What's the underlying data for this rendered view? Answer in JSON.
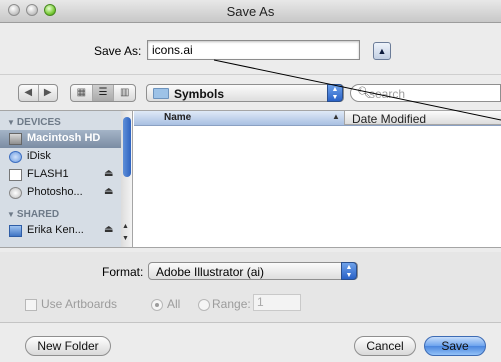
{
  "window": {
    "title": "Save As"
  },
  "save_as": {
    "label": "Save As:",
    "filename": "icons.ai",
    "toggle_icon": "up-triangle-icon"
  },
  "toolbar": {
    "back_icon": "back-arrow-icon",
    "forward_icon": "forward-arrow-icon",
    "view_icons": [
      "icon-view-icon",
      "list-view-icon",
      "column-view-icon"
    ],
    "location": "Symbols",
    "search_placeholder": "search"
  },
  "sidebar": {
    "sections": [
      {
        "heading": "DEVICES",
        "items": [
          {
            "label": "Macintosh HD",
            "selected": true,
            "icon": "hard-drive-icon",
            "eject": false
          },
          {
            "label": "iDisk",
            "selected": false,
            "icon": "idisk-icon",
            "eject": false
          },
          {
            "label": "FLASH1",
            "selected": false,
            "icon": "removable-drive-icon",
            "eject": true
          },
          {
            "label": "Photosho...",
            "selected": false,
            "icon": "disk-image-icon",
            "eject": true
          }
        ]
      },
      {
        "heading": "SHARED",
        "items": [
          {
            "label": "Erika Ken...",
            "selected": false,
            "icon": "network-computer-icon",
            "eject": true
          }
        ]
      }
    ]
  },
  "file_list": {
    "columns": [
      "Name",
      "Date Modified"
    ],
    "sorted_by": "Name"
  },
  "options": {
    "format_label": "Format:",
    "format_value": "Adobe Illustrator (ai)",
    "use_artboards_label": "Use Artboards",
    "all_label": "All",
    "range_label": "Range:",
    "range_value": "1"
  },
  "buttons": {
    "new_folder": "New Folder",
    "cancel": "Cancel",
    "save": "Save"
  },
  "colors": {
    "accent": "#4a86df",
    "sidebar_bg": "#d6dde5",
    "selection": "#7b8ca3"
  }
}
